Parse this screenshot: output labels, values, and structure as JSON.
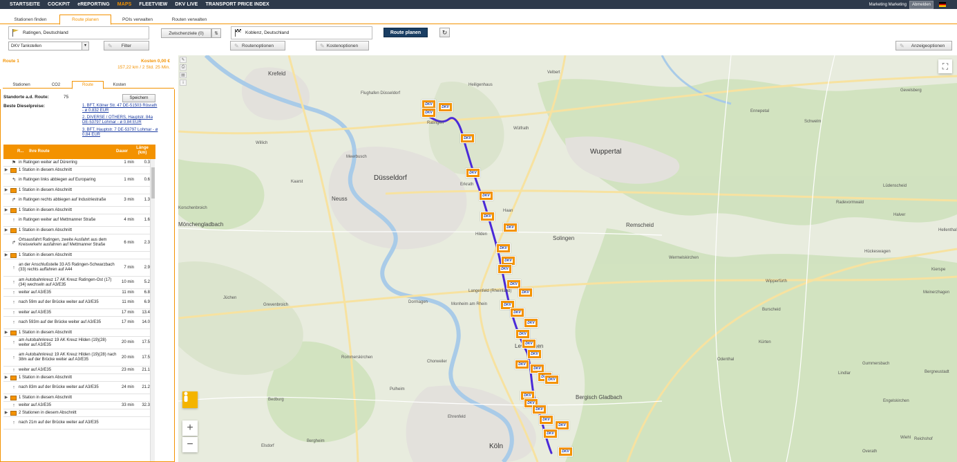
{
  "topnav": {
    "items": [
      "STARTSEITE",
      "COCKPIT",
      "eREPORTING",
      "MAPS",
      "FLEETVIEW",
      "DKV LIVE",
      "TRANSPORT PRICE INDEX"
    ],
    "active_index": 3,
    "user": "Marketing Marketing",
    "logout": "Abmelden"
  },
  "tabs": [
    "Stationen finden",
    "Route planen",
    "POIs verwalten",
    "Routen verwalten"
  ],
  "route_form": {
    "start": "Ratingen, Deutschland",
    "via_label": "Zwischenziele (0)",
    "via_swap": "⇅",
    "destination": "Koblenz, Deutschland",
    "plan_button": "Route planen",
    "reset_icon": "↻",
    "station_type": "DKV Tankstellen",
    "filter_button": "Filter",
    "route_options": "Routenoptionen",
    "cost_options": "Kostenoptionen",
    "display_options": "Anzeigeoptionen"
  },
  "route_summary": {
    "title": "Route 1",
    "cost": "Kosten 0,00 €",
    "distance_time": "157,22 km / 2 Std. 25 Min."
  },
  "subtabs": [
    "Stationen",
    "CO2",
    "Route",
    "Kosten"
  ],
  "subtab_active": 2,
  "stats": {
    "locations_label": "Standorte a.d. Route:",
    "locations_value": "75",
    "save_button": "Speichern",
    "diesel_label": "Beste Dieselpreise:",
    "diesel_links": [
      "1. BFT, Kölner Str. 47 DE-51503 Rösrath - ø 0.832 EUR",
      "2. DIVERSE / OTHERS, Hauptstr. 84a DE-53797 Lohmar - ø 0.84 EUR",
      "3. BFT, Hauptstr. 7 DE-53797 Lohmar - ø 0.84 EUR"
    ]
  },
  "table": {
    "col_r": "R...",
    "col_route": "Ihre Route",
    "col_duration": "Dauer",
    "col_length": "Länge (km)",
    "rows": [
      {
        "expand": "",
        "icon": "flag",
        "text": "in Ratingen weiter auf Dürerring",
        "dur": "1 min",
        "len": "0.3"
      },
      {
        "expand": "▶",
        "icon": "station",
        "text": "1 Station in diesem Abschnitt",
        "dur": "",
        "len": ""
      },
      {
        "expand": "",
        "icon": "left",
        "text": "in Ratingen links abbiegen auf Europaring",
        "dur": "1 min",
        "len": "0.6"
      },
      {
        "expand": "▶",
        "icon": "station",
        "text": "1 Station in diesem Abschnitt",
        "dur": "",
        "len": ""
      },
      {
        "expand": "",
        "icon": "right",
        "text": "in Ratingen rechts abbiegen auf Industriestraße",
        "dur": "3 min",
        "len": "1.3"
      },
      {
        "expand": "▶",
        "icon": "station",
        "text": "1 Station in diesem Abschnitt",
        "dur": "",
        "len": ""
      },
      {
        "expand": "",
        "icon": "up",
        "text": "in Ratingen weiter auf Mettmanner Straße",
        "dur": "4 min",
        "len": "1.6"
      },
      {
        "expand": "▶",
        "icon": "station",
        "text": "1 Station in diesem Abschnitt",
        "dur": "",
        "len": ""
      },
      {
        "expand": "",
        "icon": "right",
        "text": "Ortsausfahrt Ratingen, zweite Ausfahrt aus dem Kreisverkehr ausfahren auf Mettmanner Straße",
        "dur": "6 min",
        "len": "2.3"
      },
      {
        "expand": "▶",
        "icon": "station",
        "text": "1 Station in diesem Abschnitt",
        "dur": "",
        "len": ""
      },
      {
        "expand": "",
        "icon": "up",
        "text": "an der Anschlußstelle 33 AS Ratingen-Schwarzbach (33) rechts auffahren auf A44",
        "dur": "7 min",
        "len": "2.9"
      },
      {
        "expand": "",
        "icon": "up",
        "text": "am Autobahnkreuz 17 AK Kreuz Ratingen-Ost (17)(34) wechseln auf A3/E35",
        "dur": "10 min",
        "len": "5.2"
      },
      {
        "expand": "",
        "icon": "up",
        "text": "weiter auf A3/E35",
        "dur": "11 min",
        "len": "6.8"
      },
      {
        "expand": "",
        "icon": "up",
        "text": "nach 59m auf der Brücke weiter auf A3/E35",
        "dur": "11 min",
        "len": "6.9"
      },
      {
        "expand": "",
        "icon": "up",
        "text": "weiter auf A3/E35",
        "dur": "17 min",
        "len": "13.4"
      },
      {
        "expand": "",
        "icon": "up",
        "text": "nach 593m auf der Brücke weiter auf A3/E35",
        "dur": "17 min",
        "len": "14.0"
      },
      {
        "expand": "▶",
        "icon": "station",
        "text": "1 Station in diesem Abschnitt",
        "dur": "",
        "len": ""
      },
      {
        "expand": "",
        "icon": "up",
        "text": "am Autobahnkreuz 19 AK Kreuz Hilden (19)(28) weiter auf A3/E35",
        "dur": "20 min",
        "len": "17.5"
      },
      {
        "expand": "",
        "icon": "up",
        "text": "am Autobahnkreuz 19 AK Kreuz Hilden (19)(28) nach 38m auf der Brücke weiter auf A3/E35",
        "dur": "20 min",
        "len": "17.5"
      },
      {
        "expand": "",
        "icon": "up",
        "text": "weiter auf A3/E35",
        "dur": "23 min",
        "len": "21.1"
      },
      {
        "expand": "▶",
        "icon": "station",
        "text": "1 Station in diesem Abschnitt",
        "dur": "",
        "len": ""
      },
      {
        "expand": "",
        "icon": "up",
        "text": "nach 83m auf der Brücke weiter auf A3/E35",
        "dur": "24 min",
        "len": "21.2"
      },
      {
        "expand": "▶",
        "icon": "station",
        "text": "1 Station in diesem Abschnitt",
        "dur": "",
        "len": ""
      },
      {
        "expand": "",
        "icon": "up",
        "text": "weiter auf A3/E35",
        "dur": "33 min",
        "len": "32.3"
      },
      {
        "expand": "▶",
        "icon": "station",
        "text": "2 Stationen in diesem Abschnitt",
        "dur": "",
        "len": ""
      },
      {
        "expand": "",
        "icon": "up",
        "text": "nach 21m auf der Brücke weiter auf A3/E35",
        "dur": "",
        "len": ""
      }
    ]
  },
  "map": {
    "cities": [
      {
        "name": "Krefeld",
        "size": "mid"
      },
      {
        "name": "Düsseldorf",
        "size": "big"
      },
      {
        "name": "Wuppertal",
        "size": "big"
      },
      {
        "name": "Neuss",
        "size": "mid"
      },
      {
        "name": "Solingen",
        "size": "mid"
      },
      {
        "name": "Remscheid",
        "size": "mid"
      },
      {
        "name": "Köln",
        "size": "big"
      },
      {
        "name": "Hilden",
        "size": "small"
      },
      {
        "name": "Langenfeld (Rheinland)",
        "size": "small"
      },
      {
        "name": "Leverkusen",
        "size": "mid"
      },
      {
        "name": "Bergisch Gladbach",
        "size": "mid"
      },
      {
        "name": "Mönchengladbach",
        "size": "mid"
      },
      {
        "name": "Dormagen",
        "size": "small"
      },
      {
        "name": "Grevenbroich",
        "size": "small"
      },
      {
        "name": "Velbert",
        "size": "small"
      },
      {
        "name": "Wülfrath",
        "size": "small"
      },
      {
        "name": "Heiligenhaus",
        "size": "small"
      },
      {
        "name": "Ratingen",
        "size": "small"
      },
      {
        "name": "Meerbusch",
        "size": "small"
      },
      {
        "name": "Erkrath",
        "size": "small"
      },
      {
        "name": "Haan",
        "size": "small"
      },
      {
        "name": "Lüdenscheid",
        "size": "small"
      },
      {
        "name": "Wipperfürth",
        "size": "small"
      },
      {
        "name": "Gummersbach",
        "size": "small"
      },
      {
        "name": "Pulheim",
        "size": "small"
      },
      {
        "name": "Bergheim",
        "size": "small"
      },
      {
        "name": "Flughafen Düsseldorf",
        "size": "small"
      },
      {
        "name": "Monheim am Rhein",
        "size": "small"
      },
      {
        "name": "Willich",
        "size": "small"
      },
      {
        "name": "Kaarst",
        "size": "small"
      },
      {
        "name": "Gevelsberg",
        "size": "small"
      },
      {
        "name": "Ennepetal",
        "size": "small"
      },
      {
        "name": "Schwelm",
        "size": "small"
      },
      {
        "name": "Halver",
        "size": "small"
      },
      {
        "name": "Radevormwald",
        "size": "small"
      },
      {
        "name": "Hückeswagen",
        "size": "small"
      },
      {
        "name": "Wermelskirchen",
        "size": "small"
      },
      {
        "name": "Burscheid",
        "size": "small"
      },
      {
        "name": "Overath",
        "size": "small"
      },
      {
        "name": "Engelskirchen",
        "size": "small"
      },
      {
        "name": "Lindlar",
        "size": "small"
      },
      {
        "name": "Kürten",
        "size": "small"
      },
      {
        "name": "Odenthal",
        "size": "small"
      },
      {
        "name": "Rommerskirchen",
        "size": "small"
      },
      {
        "name": "Elsdorf",
        "size": "small"
      },
      {
        "name": "Bedburg",
        "size": "small"
      },
      {
        "name": "Jüchen",
        "size": "small"
      },
      {
        "name": "Korschenbroich",
        "size": "small"
      },
      {
        "name": "Ehrenfeld",
        "size": "small"
      },
      {
        "name": "Chorweiler",
        "size": "small"
      },
      {
        "name": "Wiehl",
        "size": "small"
      },
      {
        "name": "Reichshof",
        "size": "small"
      },
      {
        "name": "Bergneustadt",
        "size": "small"
      },
      {
        "name": "Meinerzhagen",
        "size": "small"
      },
      {
        "name": "Kierspe",
        "size": "small"
      },
      {
        "name": "Hellenthal",
        "size": "small"
      }
    ],
    "dkv_label": "DKV",
    "zoom_in": "+",
    "zoom_out": "−",
    "fullscreen_icon": "⛶",
    "pegman_icon": "person-icon"
  }
}
